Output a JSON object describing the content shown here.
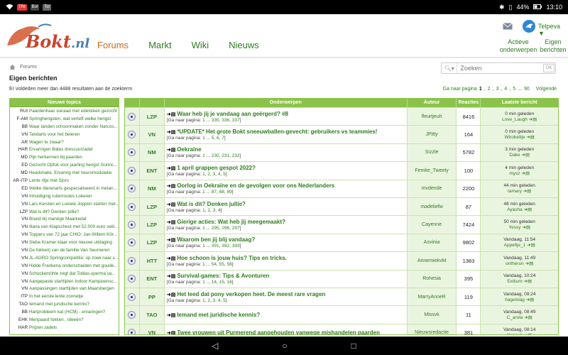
{
  "status_bar": {
    "time": "13:10",
    "battery": "44%",
    "left_badges": [
      "TRI",
      "Bol",
      "Tcr"
    ]
  },
  "header": {
    "logo_text": "Bokt",
    "logo_tld": ".nl",
    "nav": [
      "Forums",
      "Markt",
      "Wiki",
      "Nieuws"
    ],
    "user_name": "Telpeva",
    "actieve_onderwerpen": [
      "Actieve",
      "onderwerpen"
    ],
    "eigen_berichten": [
      "Eigen",
      "berichten"
    ]
  },
  "breadcrumb": "Forums",
  "page_title": "Eigen berichten",
  "result_count": "Er voldeden meer dan 4488 resultaten aan de zoekterm",
  "search": {
    "placeholder": "Zoeken",
    "ok": "OK"
  },
  "pager": {
    "label": "Ga naar pagina",
    "pages": [
      "1",
      "2",
      "3",
      "4",
      "5",
      "...",
      "90"
    ],
    "next": "Volgende"
  },
  "sidebar": {
    "title": "Nieuwe topics",
    "items": [
      {
        "tag": "RUI",
        "title": "Paardenhaar sieraad met edelsteen gezocht"
      },
      {
        "tag": "F-AM",
        "title": "Springhengsten, wat verteft welke hengst"
      },
      {
        "tag": "BB",
        "title": "Waar tanden schoonmaken zonder Narcos..."
      },
      {
        "tag": "VN",
        "title": "Tandarts voor het beleren"
      },
      {
        "tag": "AR",
        "title": "Wagen te zwaar?"
      },
      {
        "tag": "HAR",
        "title": "Ervaringen Bates dressuurzadel"
      },
      {
        "tag": "MD",
        "title": "Pijn herkennen bij paarden"
      },
      {
        "tag": "ED",
        "title": "Gezocht Opfok voor jaarling hengst Gorinc..."
      },
      {
        "tag": "MD",
        "title": "Headshake. Ervaring met neuromodulatie"
      },
      {
        "tag": "AR-ITP",
        "title": "Lente ritje met Sjors"
      },
      {
        "tag": "ED",
        "title": "Welke dierenarts gespecialiseerd in metan..."
      },
      {
        "tag": "VN",
        "title": "Inhuldiging ruiterroutes Lokeren"
      },
      {
        "tag": "VN",
        "title": "Lars Kersten en Loewie Joppen starten met..."
      },
      {
        "tag": "LZP",
        "title": "Wat is dit? Denken jullie?"
      },
      {
        "tag": "VN",
        "title": "Brand bij manège Maarkedal"
      },
      {
        "tag": "VN",
        "title": "Illana van Klapscheut met 52.000 euro veili..."
      },
      {
        "tag": "VN",
        "title": "Toppers van 72 jaar CHIO: Jan-Willem Kör..."
      },
      {
        "tag": "VN",
        "title": "Siebe Kramer klaar voor nieuwe uitdaging"
      },
      {
        "tag": "VN",
        "title": "De fokkerij van de familie Van Seumeren"
      },
      {
        "tag": "VN",
        "title": "JL-AGRO Springcompetitie: op zoek naar s..."
      },
      {
        "tag": "VN",
        "title": "Hidde Frankena onderscheiden met goude..."
      },
      {
        "tag": "VN",
        "title": "Schockemöhle zegt dat Totilas-sperma va..."
      },
      {
        "tag": "VN",
        "title": "Aangepaste starttijden Indoor Kampioensc..."
      },
      {
        "tag": "VN",
        "title": "Aanpassingen starttijden van Maarsbergen"
      },
      {
        "tag": "ITP",
        "title": "In het eerste lente zonnetje"
      },
      {
        "tag": "TAO",
        "title": "Iemand met juridische kennis?"
      },
      {
        "tag": "BB",
        "title": "Hartprobleem kat (HCM) - ervaringen?"
      },
      {
        "tag": "EHK",
        "title": "Menpaard fokken.. Ideeën?"
      },
      {
        "tag": "HAR",
        "title": "Prijzen zadels"
      }
    ]
  },
  "table": {
    "headers": [
      "Onderwerpen",
      "Auteur",
      "Reacties",
      "Laatste bericht"
    ],
    "goto_label": "Ga naar pagina:",
    "rows": [
      {
        "cat": "LZP",
        "subject": "Waar heb jij je vandaag aan geërgerd? #8",
        "pages": [
          "1",
          "...",
          "335",
          "336",
          "337"
        ],
        "author": "fleurtjeuh",
        "replies": "8416",
        "last_time": "0 min geleden",
        "last_user": "Love_Laugh"
      },
      {
        "cat": "VN",
        "subject": "*UPDATE* Het grote Bokt sneeuwballen-gevecht: gebruikers vs teammies!",
        "pages": [
          "1",
          "...",
          "5",
          "6",
          "7"
        ],
        "author": "JPitty",
        "replies": "164",
        "last_time": "0 min geleden",
        "last_user": "Wirobeltje"
      },
      {
        "cat": "NM",
        "subject": "Oekraïne",
        "pages": [
          "1",
          "...",
          "230",
          "231",
          "232"
        ],
        "author": "Sizzle",
        "replies": "5782",
        "last_time": "3 min geleden",
        "last_user": "Dake"
      },
      {
        "cat": "ENT",
        "subject": "1 april grappen gespot 2022?",
        "pages": [
          "1",
          "2",
          "3",
          "4",
          "5"
        ],
        "author": "Femke_Tweety",
        "replies": "100",
        "last_time": "4 min geleden",
        "last_user": "mysz"
      },
      {
        "cat": "NM",
        "subject": "Oorlog in Oekraïne en de gevolgen voor ons Nederlanders",
        "pages": [
          "1",
          "...",
          "87",
          "88",
          "89"
        ],
        "author": "mvdende",
        "replies": "2200",
        "last_time": "44 min geleden",
        "last_user": "tamary"
      },
      {
        "cat": "LZP",
        "subject": "Wat is dit? Denken jullie?",
        "pages": [
          "1",
          "2",
          "3",
          "4"
        ],
        "author": "madeliefw",
        "replies": "87",
        "last_time": "48 min geleden",
        "last_user": "Ayasha"
      },
      {
        "cat": "LZP",
        "subject": "Gierige acties: Wat heb jij meegemaakt?",
        "pages": [
          "1",
          "...",
          "295",
          "296",
          "297"
        ],
        "author": "Cayenne",
        "replies": "7424",
        "last_time": "50 min geleden",
        "last_user": "Yessy"
      },
      {
        "cat": "LZP",
        "subject": "Waarom ben jij blij vandaag?",
        "pages": [
          "1",
          "...",
          "391",
          "392",
          "393"
        ],
        "author": "Asvinia",
        "replies": "9802",
        "last_time": "Vandaag, 11:54",
        "last_user": "Appeltje_1"
      },
      {
        "cat": "HTT",
        "subject": "Hoe schoon is jouw huis? Tips en tricks.",
        "pages": [
          "1",
          "...",
          "54",
          "55",
          "56"
        ],
        "author": "AnnemiekvM",
        "replies": "1383",
        "last_time": "Vandaag, 11:49",
        "last_user": "ontherun"
      },
      {
        "cat": "ENT",
        "subject": "Survival-games: Tips & Avonturen",
        "pages": [
          "1",
          "...",
          "14",
          "15",
          "16"
        ],
        "author": "Rohesia",
        "replies": "395",
        "last_time": "Vandaag, 10:24",
        "last_user": "Exitium"
      },
      {
        "cat": "PP",
        "subject": "Het leed dat pony verkopen heet. De meest rare vragen",
        "pages": [
          "1",
          "2",
          "3",
          "4",
          "5"
        ],
        "author": "MarryAnneR",
        "replies": "119",
        "last_time": "Vandaag, 09:24",
        "last_user": "hagelslag"
      },
      {
        "cat": "TAO",
        "subject": "Iemand met juridische kennis?",
        "pages": [],
        "author": "Missvk",
        "replies": "11",
        "last_time": "Vandaag, 08:49",
        "last_user": "C_arola"
      },
      {
        "cat": "VN",
        "subject": "Twee vrouwen uit Purmerend aangehouden vanwege mishandelen paarden",
        "pages": [],
        "author": "Nieuwsredactie",
        "replies": "381",
        "last_time": "Vandaag, 08:14",
        "last_user": "Kapaeli"
      }
    ]
  }
}
